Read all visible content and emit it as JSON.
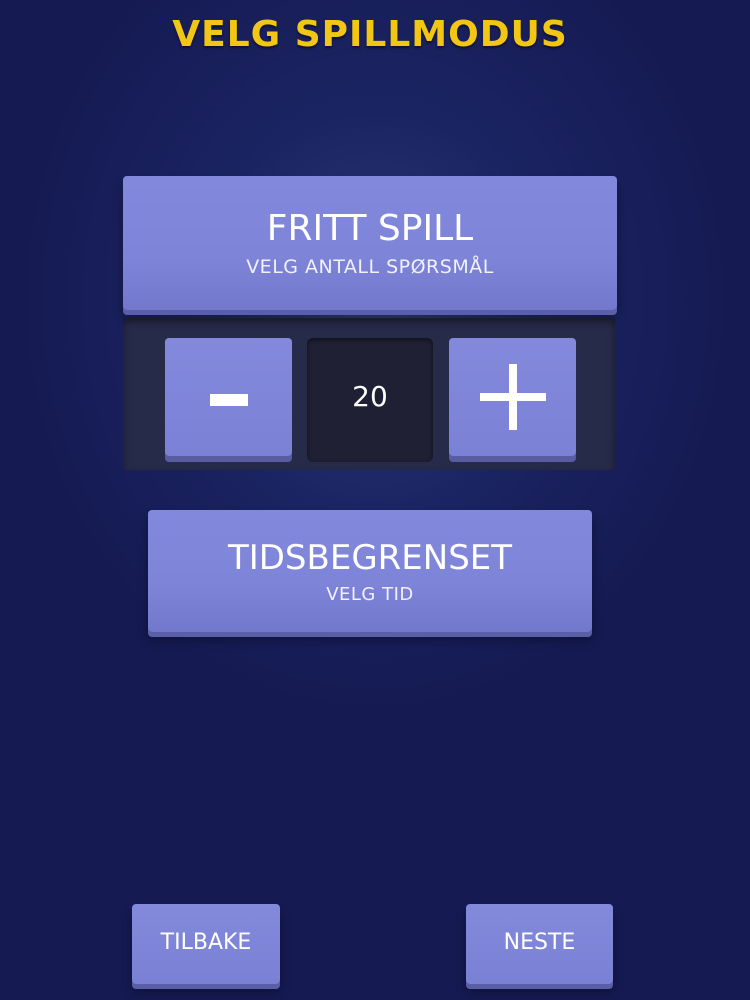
{
  "header": {
    "title": "VELG SPILLMODUS"
  },
  "modes": {
    "free_play": {
      "title": "FRITT SPILL",
      "subtitle": "VELG ANTALL SPØRSMÅL"
    },
    "timed": {
      "title": "TIDSBEGRENSET",
      "subtitle": "VELG TID"
    }
  },
  "question_stepper": {
    "decrement_icon": "minus-icon",
    "increment_icon": "plus-icon",
    "value": "20"
  },
  "navigation": {
    "back_label": "TILBAKE",
    "next_label": "NESTE"
  },
  "colors": {
    "title": "#f2c614",
    "button": "#7e84d8",
    "background": "#1b2463",
    "stepper_panel": "#272b4a",
    "count_box": "#1f2033"
  }
}
